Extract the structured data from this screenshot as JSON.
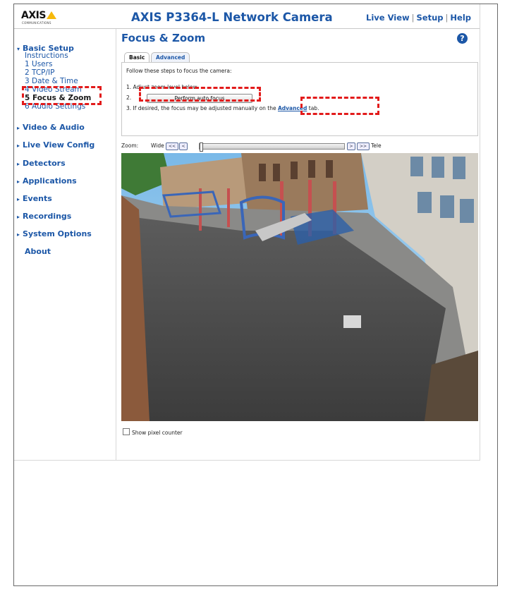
{
  "header": {
    "logo": "AXIS",
    "logo_sub": "COMMUNICATIONS",
    "title": "AXIS P3364-L Network Camera",
    "links": [
      "Live View",
      "Setup",
      "Help"
    ]
  },
  "sidebar": {
    "basic_setup": "Basic Setup",
    "sub_items": [
      "Instructions",
      "1 Users",
      "2 TCP/IP",
      "3 Date & Time",
      "4 Video Stream",
      "5 Focus & Zoom",
      "6 Audio Settings"
    ],
    "sections": [
      "Video & Audio",
      "Live View Config",
      "Detectors",
      "Applications",
      "Events",
      "Recordings",
      "System Options"
    ],
    "about": "About"
  },
  "main": {
    "page_title": "Focus & Zoom",
    "help_icon": "?",
    "tabs": [
      "Basic",
      "Advanced"
    ],
    "intro": "Follow these steps to focus the camera:",
    "step1": "1.  Adjust zoom level below.",
    "step2_num": "2.",
    "auto_focus_button": "Perform auto focus",
    "step3_pre": "3.  If desired, the focus may be adjusted manually on the",
    "step3_link": "Advanced",
    "step3_post": "tab.",
    "zoom_label": "Zoom:",
    "zoom_wide": "Wide",
    "zoom_tele": "Tele",
    "zoom_buttons": [
      "<<",
      "<",
      ">",
      ">>"
    ],
    "zoom_level": 0,
    "show_pixel_counter": "Show pixel counter"
  },
  "colors": {
    "brand_blue": "#1c57a7",
    "highlight_red": "#e21b1b",
    "logo_yellow": "#f6b90b"
  }
}
